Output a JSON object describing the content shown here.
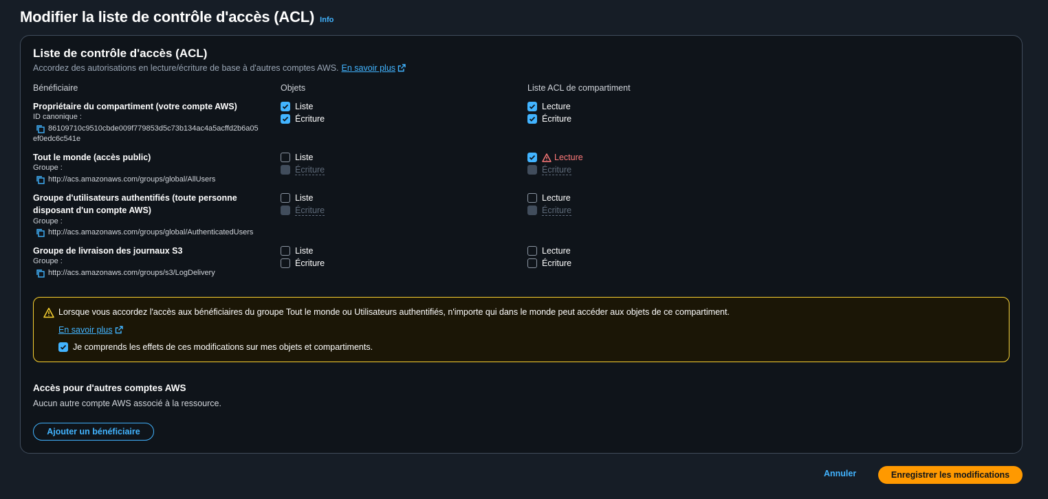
{
  "page": {
    "title": "Modifier la liste de contrôle d'accès (ACL)",
    "info_label": "Info"
  },
  "panel": {
    "title": "Liste de contrôle d'accès (ACL)",
    "description": "Accordez des autorisations en lecture/écriture de base à d'autres comptes AWS.",
    "learn_more": "En savoir plus"
  },
  "columns": {
    "grantee": "Bénéficiaire",
    "objects": "Objets",
    "bucket_acl": "Liste ACL de compartiment"
  },
  "grantees": [
    {
      "name": "Propriétaire du compartiment (votre compte AWS)",
      "sub_label": "ID canonique :",
      "id_line1": "86109710c9510cbde009f779853d5c73b134ac4a5acffd2b6a05",
      "id_line2": "ef0edc6c541e",
      "objects": {
        "list_label": "Liste",
        "list_checked": true,
        "write_label": "Écriture",
        "write_checked": true
      },
      "bucket": {
        "read_label": "Lecture",
        "read_checked": true,
        "write_label": "Écriture",
        "write_checked": true
      }
    },
    {
      "name": "Tout le monde (accès public)",
      "sub_label": "Groupe :",
      "id_line1": "http://acs.amazonaws.com/groups/global/AllUsers",
      "objects": {
        "list_label": "Liste",
        "list_checked": false,
        "write_label": "Écriture",
        "write_disabled": true
      },
      "bucket": {
        "read_label": "Lecture",
        "read_checked": true,
        "read_warning": true,
        "write_label": "Écriture",
        "write_disabled": true
      }
    },
    {
      "name_line1": "Groupe d'utilisateurs authentifiés (toute personne",
      "name_line2": "disposant d'un compte AWS)",
      "sub_label": "Groupe :",
      "id_line1": "http://acs.amazonaws.com/groups/global/AuthenticatedUsers",
      "objects": {
        "list_label": "Liste",
        "list_checked": false,
        "write_label": "Écriture",
        "write_disabled": true
      },
      "bucket": {
        "read_label": "Lecture",
        "read_checked": false,
        "write_label": "Écriture",
        "write_disabled": true
      }
    },
    {
      "name": "Groupe de livraison des journaux S3",
      "sub_label": "Groupe :",
      "id_line1": "http://acs.amazonaws.com/groups/s3/LogDelivery",
      "objects": {
        "list_label": "Liste",
        "list_checked": false,
        "write_label": "Écriture",
        "write_checked": false
      },
      "bucket": {
        "read_label": "Lecture",
        "read_checked": false,
        "write_label": "Écriture",
        "write_checked": false
      }
    }
  ],
  "warning": {
    "text": "Lorsque vous accordez l'accès aux bénéficiaires du groupe Tout le monde ou Utilisateurs authentifiés, n'importe qui dans le monde peut accéder aux objets de ce compartiment.",
    "learn_more": "En savoir plus",
    "ack_label": "Je comprends les effets de ces modifications sur mes objets et compartiments.",
    "ack_checked": true
  },
  "other_accounts": {
    "title": "Accès pour d'autres comptes AWS",
    "description": "Aucun autre compte AWS associé à la ressource.",
    "add_button": "Ajouter un bénéficiaire"
  },
  "footer": {
    "cancel": "Annuler",
    "save": "Enregistrer les modifications"
  },
  "colors": {
    "accent": "#42b4ff",
    "primary_button": "#ff9900",
    "warning_border": "#fbd332",
    "danger_text": "#ff7a7a"
  }
}
